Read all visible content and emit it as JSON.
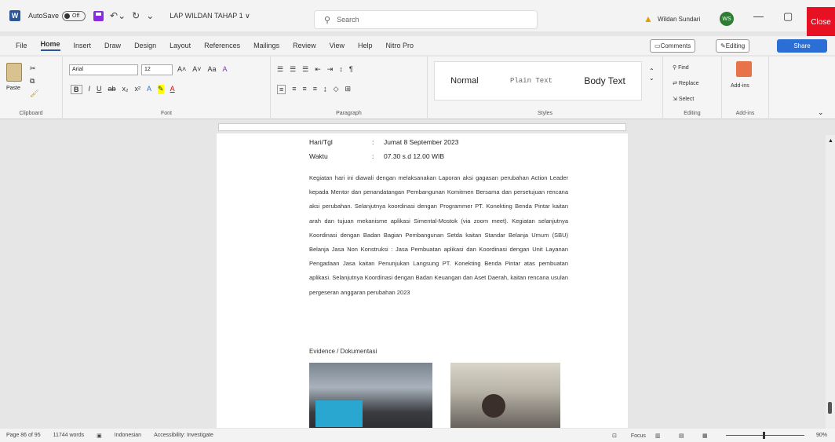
{
  "titlebar": {
    "autosave_label": "AutoSave",
    "autosave_state": "Off",
    "doc_name": "LAP WILDAN TAHAP 1 ∨",
    "search_placeholder": "Search",
    "user_name": "Wildan Sundari",
    "avatar_initials": "WS",
    "close_label": "Close"
  },
  "menu": {
    "items": [
      "File",
      "Home",
      "Insert",
      "Draw",
      "Design",
      "Layout",
      "References",
      "Mailings",
      "Review",
      "View",
      "Help",
      "Nitro Pro"
    ],
    "active": "Home",
    "comments": "Comments",
    "editing": "Editing",
    "share": "Share"
  },
  "ribbon": {
    "clipboard": {
      "paste": "Paste",
      "label": "Clipboard"
    },
    "font": {
      "name": "Arial",
      "size": "12",
      "label": "Font"
    },
    "paragraph": {
      "label": "Paragraph"
    },
    "styles": {
      "items": [
        "Normal",
        "Plain Text",
        "Body Text"
      ],
      "label": "Styles"
    },
    "editing": {
      "find": "Find",
      "replace": "Replace",
      "select": "Select",
      "label": "Editing"
    },
    "addins": {
      "label": "Add-ins",
      "btn": "Add-ins"
    }
  },
  "document": {
    "hari_label": "Hari/Tgl",
    "hari_value": "Jumat 8 September 2023",
    "waktu_label": "Waktu",
    "waktu_value": "07.30 s.d 12.00 WIB",
    "paragraph": "Kegiatan hari ini diawali dengan melaksanakan Laporan aksi gagasan perubahan Action Leader kepada Mentor dan penandatangan Pembangunan Komitmen Bersama dan persetujuan rencana aksi perubahan. Selanjutnya koordinasi dengan Programmer PT. Konekting Benda Pintar kaitan arah dan tujuan mekanisme aplikasi Simental-Mostok (via zoom meet). Kegiatan selanjutnya Koordinasi dengan Badan Bagian Pembangunan Setda kaitan Standar Belanja Umum (SBU) Belanja Jasa Non Konstruksi : Jasa Pembuatan aplikasi dan Koordinasi dengan Unit Layanan Pengadaan Jasa kaitan Penunjukan Langsung PT. Konekting Benda Pintar atas pembuatan aplikasi. Selanjutnya Koordinasi dengan Badan Keuangan dan Aset Daerah, kaitan rencana usulan pergeseran anggaran perubahan 2023",
    "evidence": "Evidence / Dokumentasi"
  },
  "status": {
    "page": "Page 86 of 95",
    "words": "11744 words",
    "language": "Indonesian",
    "accessibility": "Accessibility: Investigate",
    "focus": "Focus",
    "zoom": "90%"
  }
}
